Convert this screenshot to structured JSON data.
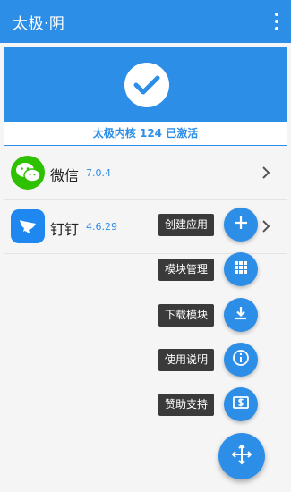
{
  "appbar": {
    "title": "太极·阴",
    "more_icon": "more-vert-icon"
  },
  "status": {
    "text": "太极内核 124 已激活",
    "icon": "check-icon"
  },
  "apps": [
    {
      "name": "微信",
      "version": "7.0.4",
      "icon": "wechat-icon"
    },
    {
      "name": "钉钉",
      "version": "4.6.29",
      "icon": "dingtalk-icon"
    }
  ],
  "fab_menu": [
    {
      "label": "创建应用",
      "icon": "plus-icon"
    },
    {
      "label": "模块管理",
      "icon": "grid-icon"
    },
    {
      "label": "下载模块",
      "icon": "download-icon"
    },
    {
      "label": "使用说明",
      "icon": "info-icon"
    },
    {
      "label": "赞助支持",
      "icon": "donate-icon"
    }
  ],
  "fab_main": {
    "icon": "move-arrows-icon"
  },
  "colors": {
    "primary": "#2d8ee8",
    "wechat": "#2dc100",
    "dingtalk": "#1e88f0",
    "label_bg": "#3a3a3a"
  }
}
